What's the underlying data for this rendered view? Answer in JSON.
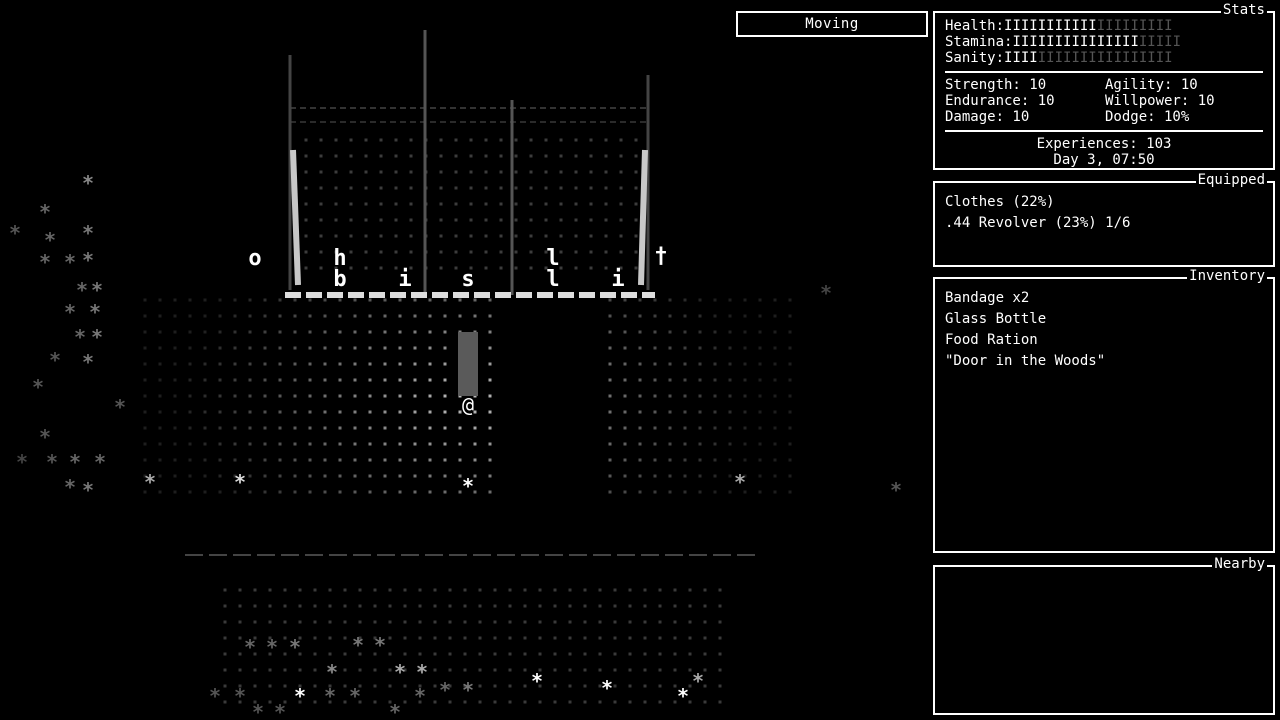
{
  "status": {
    "mode": "Moving"
  },
  "stats": {
    "title": "Stats",
    "bars": [
      {
        "label": "Health:",
        "value": 11,
        "max": 20
      },
      {
        "label": "Stamina:",
        "value": 15,
        "max": 20
      },
      {
        "label": "Sanity:",
        "value": 4,
        "max": 20
      }
    ],
    "attributes": [
      {
        "text": "Strength: 10"
      },
      {
        "text": "Agility: 10"
      },
      {
        "text": "Endurance: 10"
      },
      {
        "text": "Willpower: 10"
      },
      {
        "text": "Damage: 10"
      },
      {
        "text": "Dodge: 10%"
      }
    ],
    "experiences": "Experiences: 103",
    "time": "Day 3, 07:50"
  },
  "equipped": {
    "title": "Equipped",
    "items": [
      "Clothes (22%)",
      ".44 Revolver (23%) 1/6"
    ]
  },
  "inventory": {
    "title": "Inventory",
    "items": [
      "Bandage x2",
      "Glass Bottle",
      "Food Ration",
      "\"Door in the Woods\""
    ]
  },
  "nearby": {
    "title": "Nearby",
    "items": []
  },
  "map": {
    "player_glyph": "@",
    "entities": [
      {
        "glyph": "o",
        "name": "map-glyph-o"
      },
      {
        "glyph": "h",
        "name": "map-glyph-h"
      },
      {
        "glyph": "b",
        "name": "map-glyph-b"
      },
      {
        "glyph": "i",
        "name": "map-glyph-i"
      },
      {
        "glyph": "s",
        "name": "map-glyph-s"
      },
      {
        "glyph": "l",
        "name": "map-glyph-l"
      },
      {
        "glyph": "l",
        "name": "map-glyph-l"
      },
      {
        "glyph": "i",
        "name": "map-glyph-i"
      },
      {
        "glyph": "t",
        "name": "map-glyph-cross"
      }
    ],
    "tree_glyph": "*",
    "wall_color": "#ffffff",
    "floor_color": "#9a9a9a"
  }
}
